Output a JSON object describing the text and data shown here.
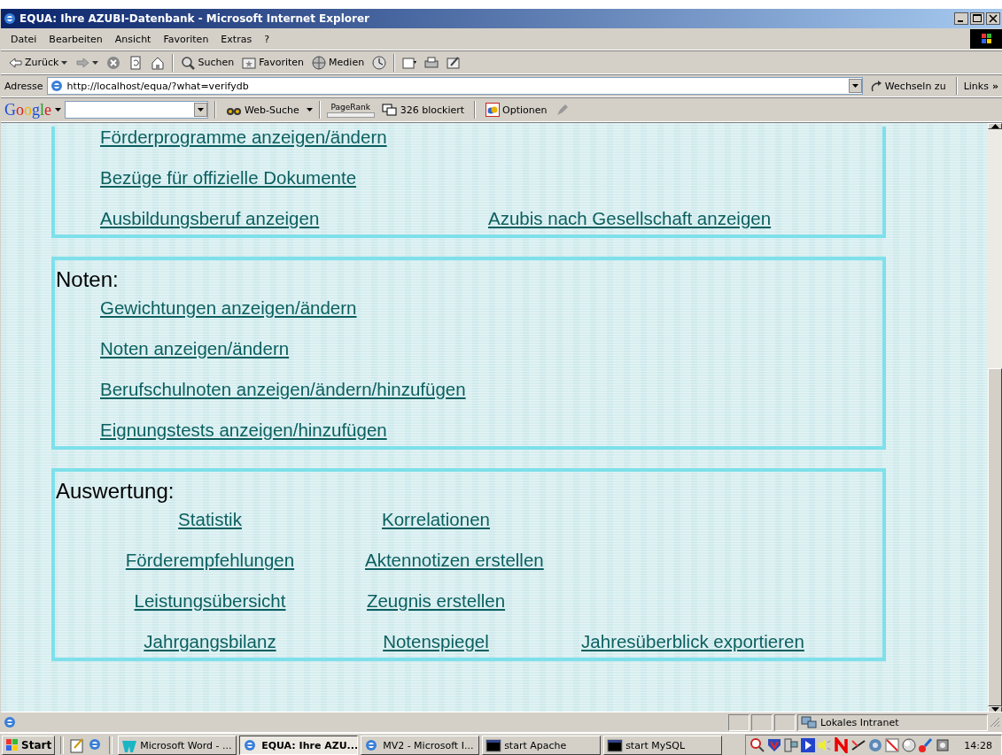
{
  "window": {
    "title": "EQUA: Ihre AZUBI-Datenbank - Microsoft Internet Explorer"
  },
  "menu": [
    "Datei",
    "Bearbeiten",
    "Ansicht",
    "Favoriten",
    "Extras",
    "?"
  ],
  "toolbar": [
    {
      "kind": "back",
      "label": "Zurück"
    },
    {
      "kind": "forward"
    },
    {
      "kind": "stop"
    },
    {
      "kind": "refresh"
    },
    {
      "kind": "home"
    },
    {
      "kind": "search",
      "label": "Suchen"
    },
    {
      "kind": "favorites",
      "label": "Favoriten"
    },
    {
      "kind": "media",
      "label": "Medien"
    },
    {
      "kind": "history"
    },
    {
      "kind": "mail"
    },
    {
      "kind": "print"
    },
    {
      "kind": "edit"
    }
  ],
  "address": {
    "label": "Adresse",
    "url": "http://localhost/equa/?what=verifydb",
    "go": "Wechseln zu",
    "links": "Links",
    "more": "»"
  },
  "google": {
    "logo": "Google",
    "search": "Web-Suche",
    "pagerank": "PageRank",
    "blocked": "326 blockiert",
    "options": "Optionen"
  },
  "sections": [
    {
      "kind": "list",
      "rows": [
        [
          "Förderprogramme anzeigen/ändern"
        ],
        [
          "Bezüge für offizielle Dokumente"
        ],
        [
          "Ausbildungsberuf anzeigen",
          "Azubis nach Gesellschaft anzeigen"
        ]
      ]
    },
    {
      "kind": "list",
      "heading": "Noten:",
      "rows": [
        [
          "Gewichtungen anzeigen/ändern"
        ],
        [
          "Noten anzeigen/ändern"
        ],
        [
          "Berufschulnoten anzeigen/ändern/hinzufügen"
        ],
        [
          "Eignungstests anzeigen/hinzufügen"
        ]
      ]
    },
    {
      "kind": "grid",
      "heading": "Auswertung:",
      "rows": [
        [
          "Statistik",
          "Korrelationen"
        ],
        [
          "Förderempfehlungen",
          "Aktennotizen erstellen"
        ],
        [
          "Leistungsübersicht",
          "Zeugnis erstellen"
        ],
        [
          "Jahrgangsbilanz",
          "Notenspiegel",
          "Jahresüberblick exportieren"
        ]
      ]
    }
  ],
  "status_bar": {
    "zone": "Lokales Intranet"
  },
  "taskbar": {
    "start": "Start",
    "tasks": [
      {
        "label": "Microsoft Word - ...",
        "kind": "word",
        "selected": false
      },
      {
        "label": "EQUA: Ihre AZU...",
        "kind": "browser",
        "selected": true
      },
      {
        "label": "MV2 - Microsoft I...",
        "kind": "browser",
        "selected": false
      },
      {
        "label": "start Apache",
        "kind": "console",
        "selected": false
      },
      {
        "label": "start MySQL",
        "kind": "console",
        "selected": false
      }
    ],
    "clock": "14:28"
  }
}
